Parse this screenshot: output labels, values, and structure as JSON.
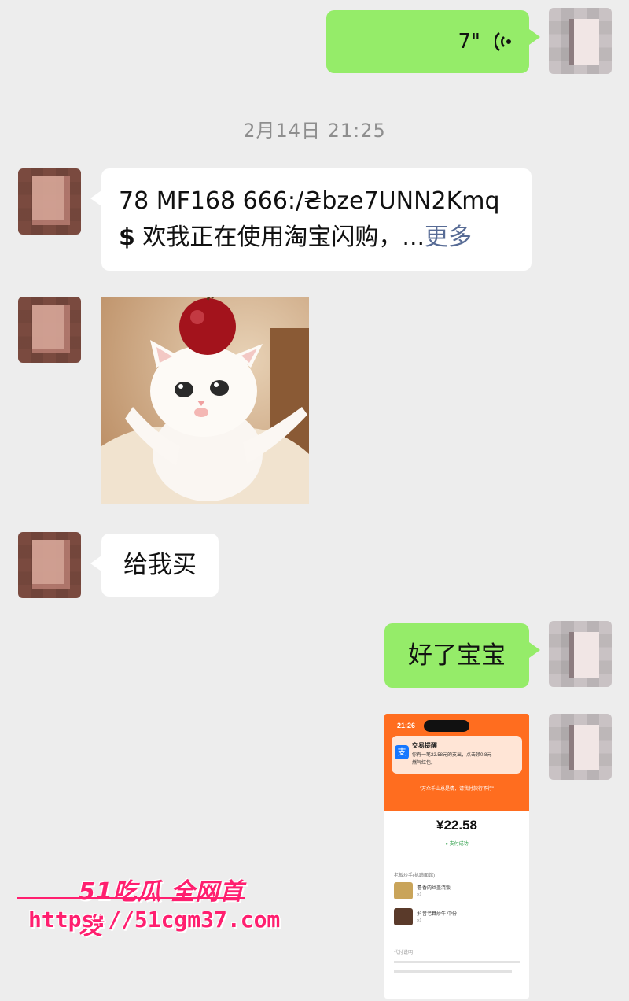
{
  "messages": {
    "voice": {
      "duration": "7\""
    },
    "timestamp": "2月14日 21:25",
    "link": {
      "line1": "78 MF168 666:/₴bze7UNN2Kmq",
      "line2_icon": "$",
      "line2_text": "欢我正在使用淘宝闪购，...",
      "more": "更多"
    },
    "request": "给我买",
    "reply": "好了宝宝"
  },
  "icons": {
    "voice": "voice-wave-icon",
    "money": "dollar-sign-icon"
  },
  "payment": {
    "time": "21:26",
    "notice_title": "交易提醒",
    "notice_body": "你有一笔22.58元的支出，点击领0.8元",
    "notice_body2": "燃气红包。",
    "slogan": "\"万众千山总是情，请我付款行不行\"",
    "amount": "¥22.58",
    "paid": "支付成功",
    "section": "老板炒手(扒蹄面馆)",
    "item1": "鲁香肉丝盖浇饭",
    "item1_qty": "x1",
    "item2": "抖音老算炒牛·中份",
    "item2_qty": "x1",
    "footer": "代付说明"
  },
  "watermark": {
    "title": "51吃瓜 全网首发",
    "url": "https://51cgm37.com"
  },
  "colors": {
    "background": "#ededed",
    "self_bubble": "#95ec69",
    "friend_bubble": "#ffffff",
    "link_blue": "#576b95",
    "payment_orange": "#ff6d1f",
    "watermark": "#ff1f6f"
  }
}
